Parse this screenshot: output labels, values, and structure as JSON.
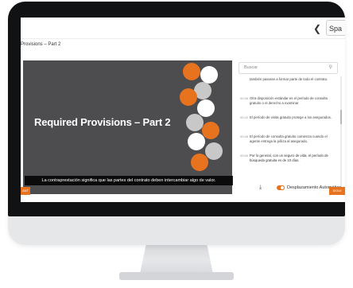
{
  "header": {
    "back_icon": "chevron-left-icon",
    "back_label": "❮",
    "language": "Spa"
  },
  "page": {
    "title": "Provisions – Part 2"
  },
  "video": {
    "title": "Required Provisions – Part 2",
    "caption": "La contraprestación significa que las partes del contrato deben intercambiar algo de valor."
  },
  "transcript": {
    "search_placeholder": "Buscar",
    "search_icon": "search-icon",
    "entries": [
      {
        "time": "",
        "text": "también pasaran a formar parte de todo el contrato."
      },
      {
        "time": "00:36",
        "text": "Otra disposición estándar es el período de consulta gratuito o el derecho a examinar."
      },
      {
        "time": "00:42",
        "text": "El período de visita gratuito protege a los asegurados."
      },
      {
        "time": "00:48",
        "text": "El período de consulta gratuito comienza cuando el agente entrega la póliza al asegurado."
      },
      {
        "time": "00:55",
        "text": "Por lo general, con un seguro de vida, el período de búsqueda gratuita es de 10 días."
      }
    ],
    "autoscroll_label": "Desplazamiento Automático",
    "autoscroll_on": true
  },
  "nav": {
    "prev_label": "ANT",
    "next_label": "SIGUI"
  },
  "colors": {
    "accent": "#e8731f",
    "video_bg": "#4d4d4f"
  }
}
